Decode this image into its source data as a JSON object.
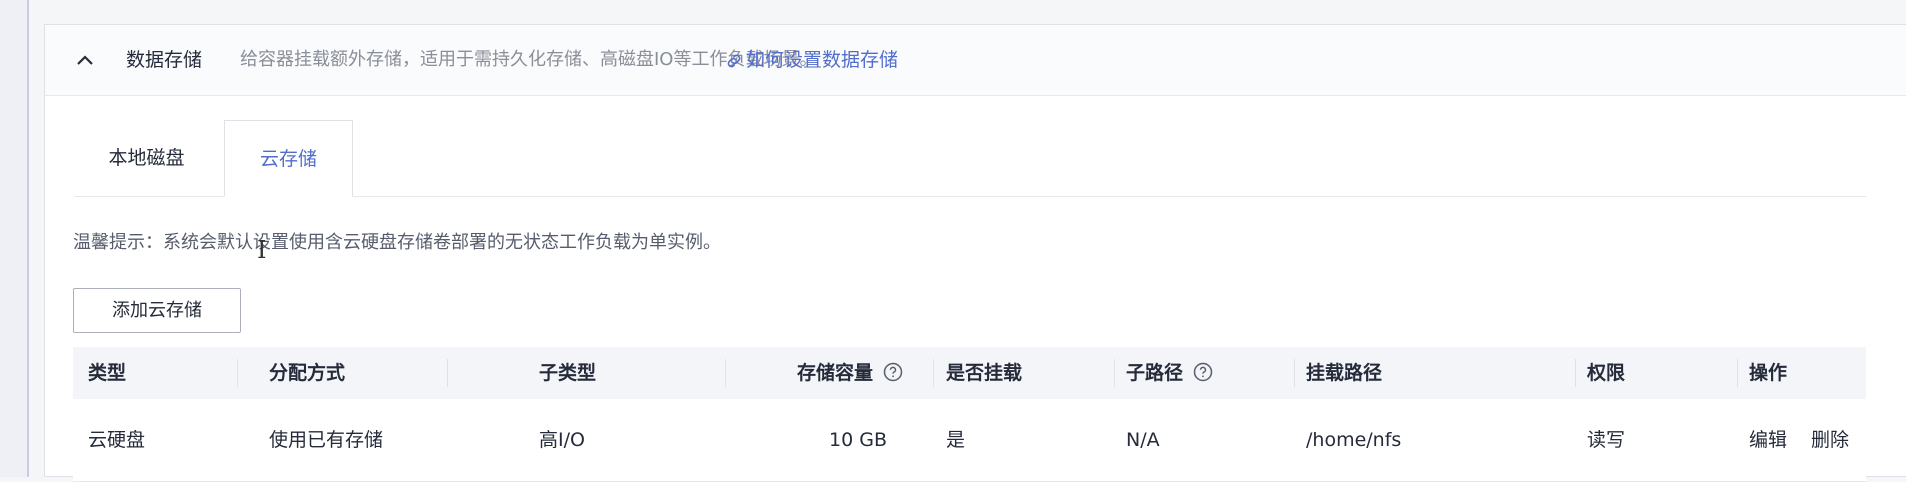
{
  "section": {
    "title": "数据存储",
    "description": "给容器挂载额外存储，适用于需持久化存储、高磁盘IO等工作负载场景。",
    "help_link": "如何设置数据存储"
  },
  "tabs": [
    {
      "label": "本地磁盘",
      "active": false
    },
    {
      "label": "云存储",
      "active": true
    }
  ],
  "tip": "温馨提示：系统会默认设置使用含云硬盘存储卷部署的无状态工作负载为单实例。",
  "add_button": "添加云存储",
  "table": {
    "headers": {
      "type": "类型",
      "alloc": "分配方式",
      "subtype": "子类型",
      "capacity": "存储容量",
      "mounted": "是否挂载",
      "subpath": "子路径",
      "mount_path": "挂载路径",
      "permission": "权限",
      "actions": "操作"
    },
    "rows": [
      {
        "type": "云硬盘",
        "alloc": "使用已有存储",
        "subtype": "高I/O",
        "capacity": "10 GB",
        "mounted": "是",
        "subpath": "N/A",
        "mount_path": "/home/nfs",
        "permission": "读写",
        "edit": "编辑",
        "delete": "删除"
      }
    ]
  },
  "colors": {
    "link": "#526ecc",
    "text": "#252b3a",
    "muted": "#8a8e99"
  },
  "icons": [
    "chevron-up-icon",
    "link-icon",
    "question-circle-icon",
    "text-cursor-icon"
  ]
}
